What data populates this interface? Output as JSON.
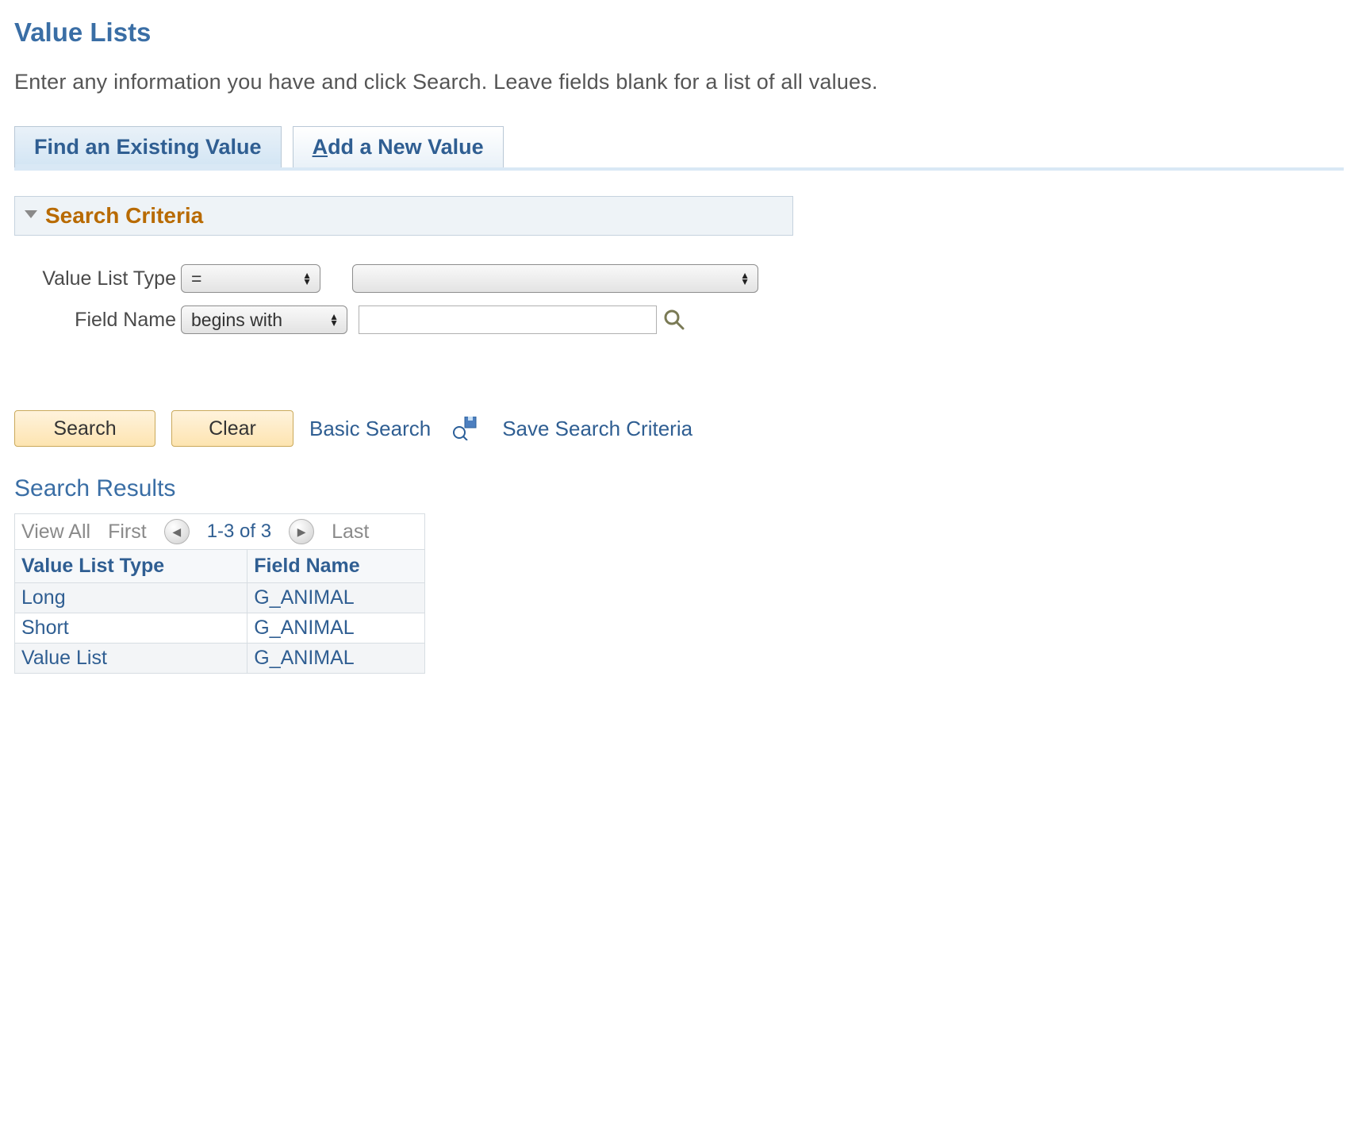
{
  "page": {
    "title": "Value Lists",
    "help": "Enter any information you have and click Search. Leave fields blank for a list of all values."
  },
  "tabs": {
    "find": "Find an Existing Value",
    "add_prefix": "A",
    "add_rest": "dd a New Value"
  },
  "criteria": {
    "header": "Search Criteria",
    "row1_label": "Value List Type",
    "row1_op": "=",
    "row1_value": "",
    "row2_label": "Field Name",
    "row2_op": "begins with",
    "row2_value": ""
  },
  "actions": {
    "search": "Search",
    "clear": "Clear",
    "basic": "Basic Search",
    "save_criteria": "Save Search Criteria"
  },
  "results": {
    "heading": "Search Results",
    "view_all": "View All",
    "first": "First",
    "last": "Last",
    "count": "1-3 of 3",
    "columns": {
      "c0": "Value List Type",
      "c1": "Field Name"
    },
    "rows": [
      {
        "c0": "Long",
        "c1": "G_ANIMAL"
      },
      {
        "c0": "Short",
        "c1": "G_ANIMAL"
      },
      {
        "c0": "Value List",
        "c1": "G_ANIMAL"
      }
    ]
  }
}
